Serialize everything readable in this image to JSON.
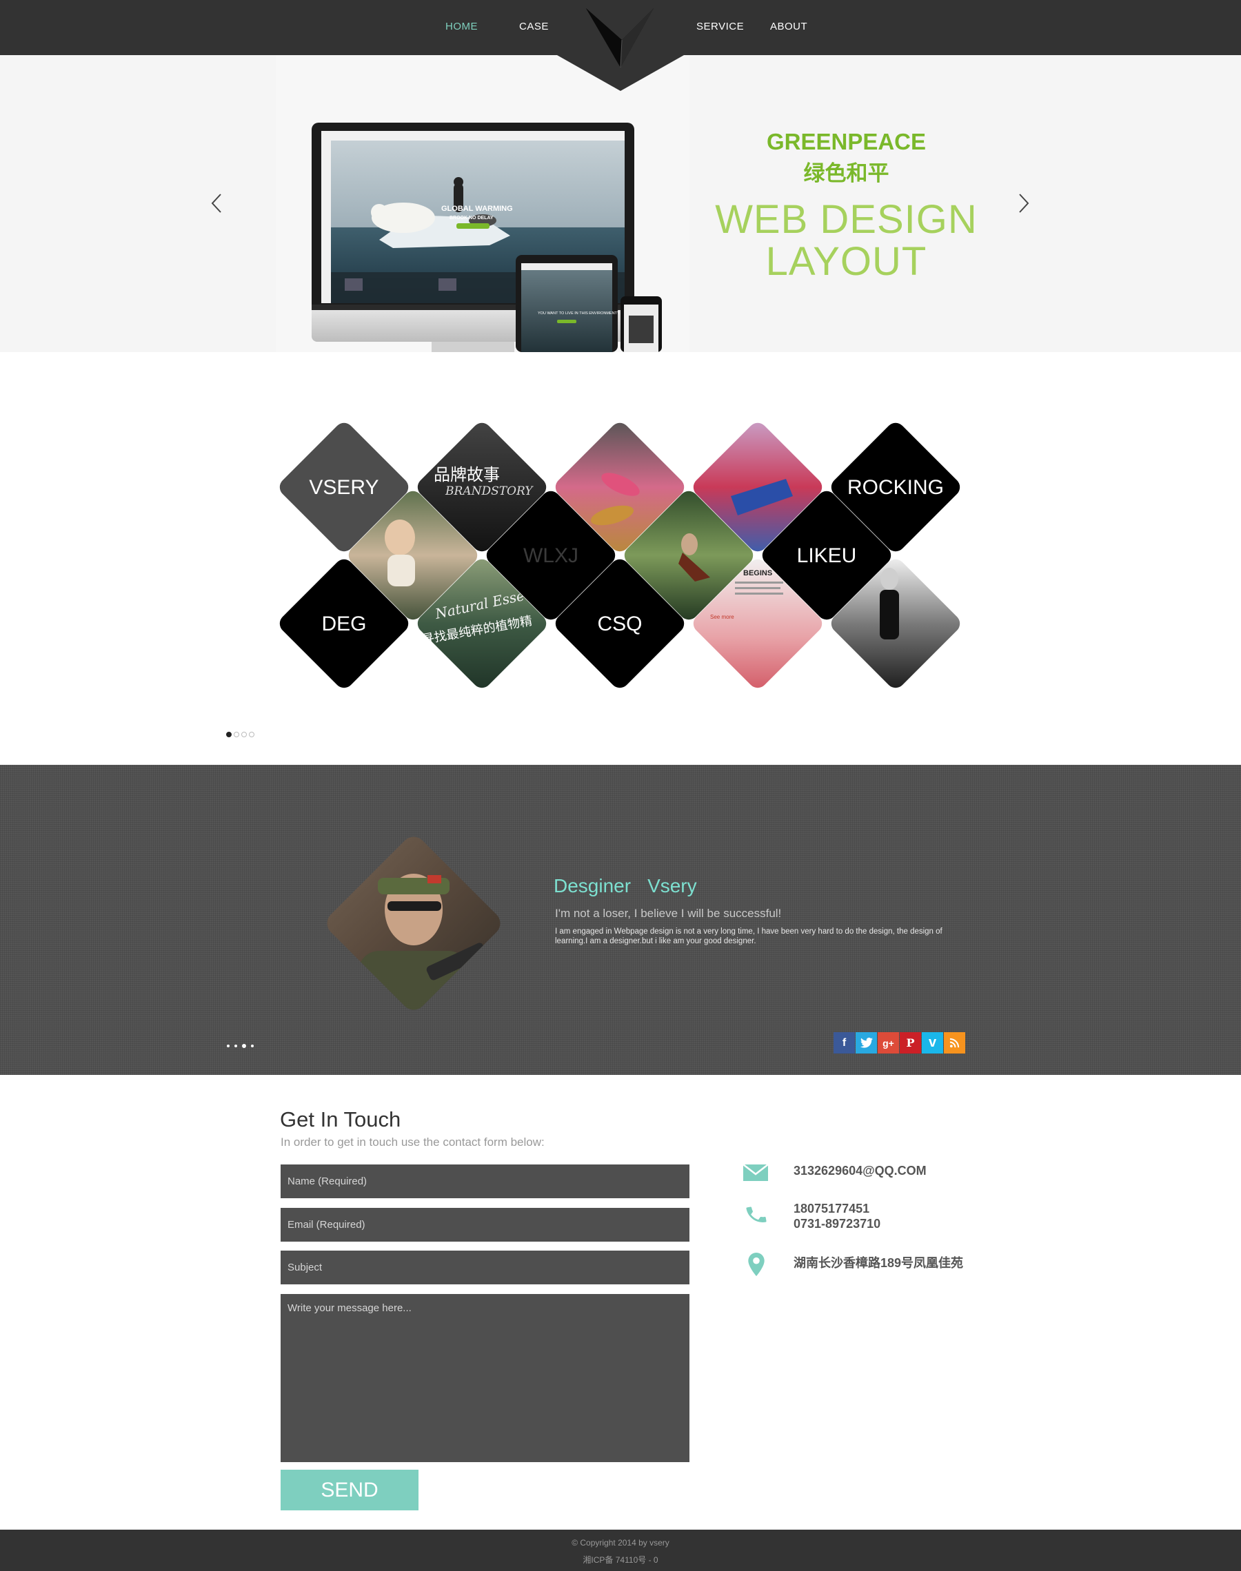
{
  "nav": {
    "items": [
      {
        "label": "HOME",
        "active": true
      },
      {
        "label": "CASE",
        "active": false
      },
      {
        "label": "SERVICE",
        "active": false
      },
      {
        "label": "ABOUT",
        "active": false
      }
    ]
  },
  "hero": {
    "brand": "GREENPEACE",
    "brand_cn": "绿色和平",
    "title_line1": "WEB DESIGN",
    "title_line2": "LAYOUT",
    "screen_caption": "GLOBAL WARMING",
    "screen_caption2": "BROOK NO DELAY",
    "tablet_caption": "YOU WANT TO LIVE IN THIS ENVIRONMENT?"
  },
  "cases": {
    "tiles": [
      "VSERY",
      "ROCKING",
      "WLXJ",
      "LIKEU",
      "DEG",
      "CSQ"
    ],
    "image_tiles": {
      "brand_story_cn": "品牌故事",
      "brand_story_en": "BRANDSTORY",
      "natural_en": "Natural Esse",
      "natural_cn": "寻找最纯粹的植物精",
      "racing_title": "BEGINS",
      "see_more": "See more"
    },
    "pager": {
      "total": 4,
      "active": 0
    }
  },
  "about": {
    "title": "Desginer",
    "name": "Vsery",
    "motto": "I'm not a loser, I believe I will be successful!",
    "description": "I am engaged in Webpage design is not a very long time, I have been very hard to do the design, the design of learning.I am a designer.but i like am your good designer.",
    "pager": {
      "total": 4,
      "active": 2
    },
    "social": [
      {
        "icon": "facebook-icon",
        "glyph": "f",
        "color": "#3b5998"
      },
      {
        "icon": "twitter-icon",
        "glyph": "t",
        "color": "#29a9e1"
      },
      {
        "icon": "google-plus-icon",
        "glyph": "g+",
        "color": "#dd4b39"
      },
      {
        "icon": "pinterest-icon",
        "glyph": "P",
        "color": "#cb2027"
      },
      {
        "icon": "vimeo-icon",
        "glyph": "v",
        "color": "#1ab7ea"
      },
      {
        "icon": "rss-icon",
        "glyph": "rss",
        "color": "#f7931e"
      }
    ]
  },
  "contact": {
    "title": "Get In Touch",
    "subtitle": "In order to get in touch use the contact form below:",
    "name_placeholder": "Name (Required)",
    "email_placeholder": "Email (Required)",
    "subject_placeholder": "Subject",
    "message_placeholder": "Write your message here...",
    "send_label": "SEND",
    "email": "3132629604@QQ.COM",
    "phone1": "18075177451",
    "phone2": "0731-89723710",
    "address": "湖南长沙香樟路189号凤凰佳苑",
    "accent": "#7ecfbf"
  },
  "footer": {
    "copyright": "© Copyright 2014 by vsery",
    "icp": "湘ICP备 74110号 - 0"
  }
}
